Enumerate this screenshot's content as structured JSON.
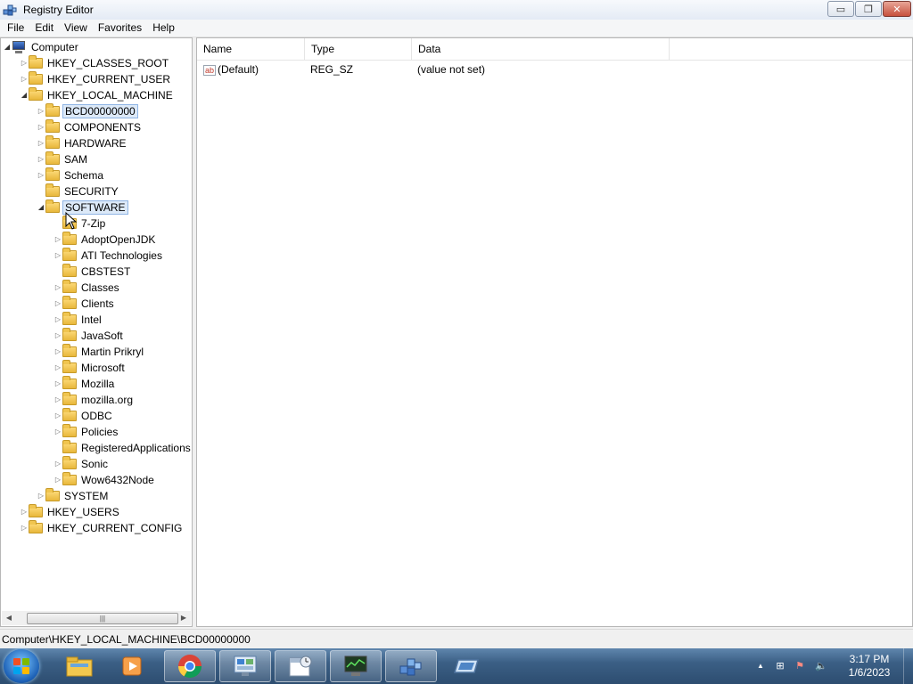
{
  "window": {
    "title": "Registry Editor",
    "minimize_glyph": "▭",
    "maximize_glyph": "❐",
    "close_glyph": "✕"
  },
  "menu": [
    "File",
    "Edit",
    "View",
    "Favorites",
    "Help"
  ],
  "tree": [
    {
      "label": "Computer",
      "depth": 0,
      "expander": "open",
      "icon": "computer-icon"
    },
    {
      "label": "HKEY_CLASSES_ROOT",
      "depth": 1,
      "expander": "closed"
    },
    {
      "label": "HKEY_CURRENT_USER",
      "depth": 1,
      "expander": "closed"
    },
    {
      "label": "HKEY_LOCAL_MACHINE",
      "depth": 1,
      "expander": "open"
    },
    {
      "label": "BCD00000000",
      "depth": 2,
      "expander": "closed",
      "selected": true
    },
    {
      "label": "COMPONENTS",
      "depth": 2,
      "expander": "closed"
    },
    {
      "label": "HARDWARE",
      "depth": 2,
      "expander": "closed"
    },
    {
      "label": "SAM",
      "depth": 2,
      "expander": "closed"
    },
    {
      "label": "Schema",
      "depth": 2,
      "expander": "closed"
    },
    {
      "label": "SECURITY",
      "depth": 2,
      "expander": "none"
    },
    {
      "label": "SOFTWARE",
      "depth": 2,
      "expander": "open",
      "focused": true
    },
    {
      "label": "7-Zip",
      "depth": 3,
      "expander": "none"
    },
    {
      "label": "AdoptOpenJDK",
      "depth": 3,
      "expander": "closed"
    },
    {
      "label": "ATI Technologies",
      "depth": 3,
      "expander": "closed"
    },
    {
      "label": "CBSTEST",
      "depth": 3,
      "expander": "none"
    },
    {
      "label": "Classes",
      "depth": 3,
      "expander": "closed"
    },
    {
      "label": "Clients",
      "depth": 3,
      "expander": "closed"
    },
    {
      "label": "Intel",
      "depth": 3,
      "expander": "closed"
    },
    {
      "label": "JavaSoft",
      "depth": 3,
      "expander": "closed"
    },
    {
      "label": "Martin Prikryl",
      "depth": 3,
      "expander": "closed"
    },
    {
      "label": "Microsoft",
      "depth": 3,
      "expander": "closed"
    },
    {
      "label": "Mozilla",
      "depth": 3,
      "expander": "closed"
    },
    {
      "label": "mozilla.org",
      "depth": 3,
      "expander": "closed"
    },
    {
      "label": "ODBC",
      "depth": 3,
      "expander": "closed"
    },
    {
      "label": "Policies",
      "depth": 3,
      "expander": "closed"
    },
    {
      "label": "RegisteredApplications",
      "depth": 3,
      "expander": "none"
    },
    {
      "label": "Sonic",
      "depth": 3,
      "expander": "closed"
    },
    {
      "label": "Wow6432Node",
      "depth": 3,
      "expander": "closed"
    },
    {
      "label": "SYSTEM",
      "depth": 2,
      "expander": "closed"
    },
    {
      "label": "HKEY_USERS",
      "depth": 1,
      "expander": "closed"
    },
    {
      "label": "HKEY_CURRENT_CONFIG",
      "depth": 1,
      "expander": "closed"
    }
  ],
  "list": {
    "columns": [
      "Name",
      "Type",
      "Data"
    ],
    "rows": [
      {
        "name": "(Default)",
        "type": "REG_SZ",
        "data": "(value not set)",
        "icon_glyph": "ab"
      }
    ]
  },
  "scrollbar": {
    "left_arrow": "◀",
    "right_arrow": "▶",
    "thumb_grip": "|||"
  },
  "status": {
    "path": "Computer\\HKEY_LOCAL_MACHINE\\BCD00000000"
  },
  "taskbar": {
    "apps": [
      "explorer-icon",
      "media-player-icon",
      "chrome-icon",
      "control-panel-icon",
      "calendar-icon",
      "monitor-icon",
      "regedit-icon",
      "remote-desktop-icon"
    ],
    "clock_time": "3:17 PM",
    "clock_date": "1/6/2023",
    "tray_up_glyph": "▲",
    "tray_network_glyph": "⊞",
    "tray_flag_glyph": "⚑",
    "tray_volume_glyph": "🔈"
  }
}
